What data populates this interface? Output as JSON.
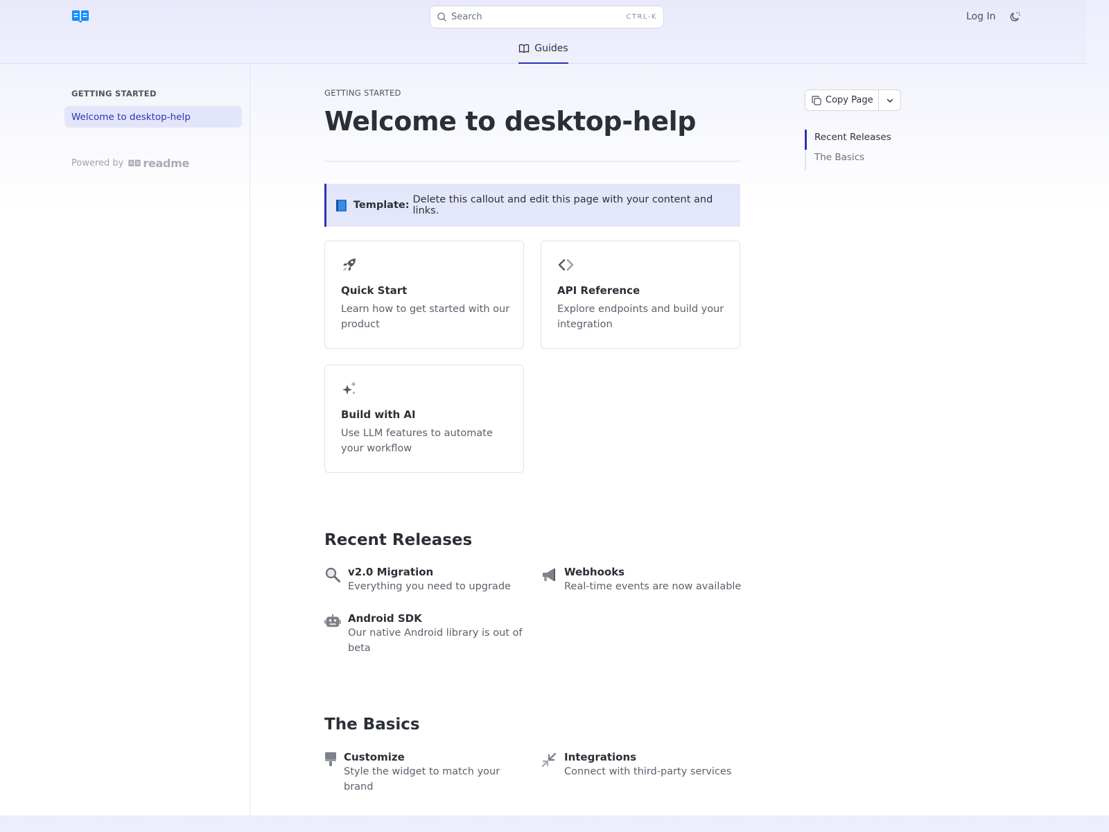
{
  "header": {
    "search": {
      "placeholder": "Search",
      "shortcut": "CTRL-K"
    },
    "login_label": "Log In",
    "tab": {
      "label": "Guides",
      "icon": "book-open-icon"
    }
  },
  "sidebar": {
    "section_title": "GETTING STARTED",
    "items": [
      {
        "label": "Welcome to desktop-help",
        "active": true
      }
    ],
    "powered_by": "Powered by",
    "powered_brand": "readme"
  },
  "main": {
    "breadcrumb": "GETTING STARTED",
    "title": "Welcome to desktop-help",
    "callout": {
      "emoji": "blue-book-icon",
      "label": "Template:",
      "text": "Delete this callout and edit this page with your content and links."
    },
    "cards": [
      {
        "icon": "rocket-icon",
        "title": "Quick Start",
        "description": "Learn how to get started with our product"
      },
      {
        "icon": "code-brackets-icon",
        "title": "API Reference",
        "description": "Explore endpoints and build your integration"
      },
      {
        "icon": "sparkles-icon",
        "title": "Build with AI",
        "description": "Use LLM features to automate your workflow"
      }
    ],
    "recent_releases": {
      "heading": "Recent Releases",
      "items": [
        {
          "icon": "magnifying-glass-icon",
          "title": "v2.0 Migration",
          "description": "Everything you need to upgrade"
        },
        {
          "icon": "megaphone-icon",
          "title": "Webhooks",
          "description": "Real-time events are now available"
        },
        {
          "icon": "robot-icon",
          "title": "Android SDK",
          "description": "Our native Android library is out of beta"
        }
      ]
    },
    "basics": {
      "heading": "The Basics",
      "items": [
        {
          "icon": "paintbrush-icon",
          "title": "Customize",
          "description": "Style the widget to match your brand"
        },
        {
          "icon": "arrows-inward-icon",
          "title": "Integrations",
          "description": "Connect with third-party services"
        }
      ]
    }
  },
  "toc": {
    "copy_label": "Copy Page",
    "items": [
      {
        "label": "Recent Releases",
        "active": true
      },
      {
        "label": "The Basics",
        "active": false
      }
    ]
  },
  "colors": {
    "accent": "#2a33b8",
    "callout_bg": "#e4e6fb",
    "logo": "#118cfd"
  }
}
